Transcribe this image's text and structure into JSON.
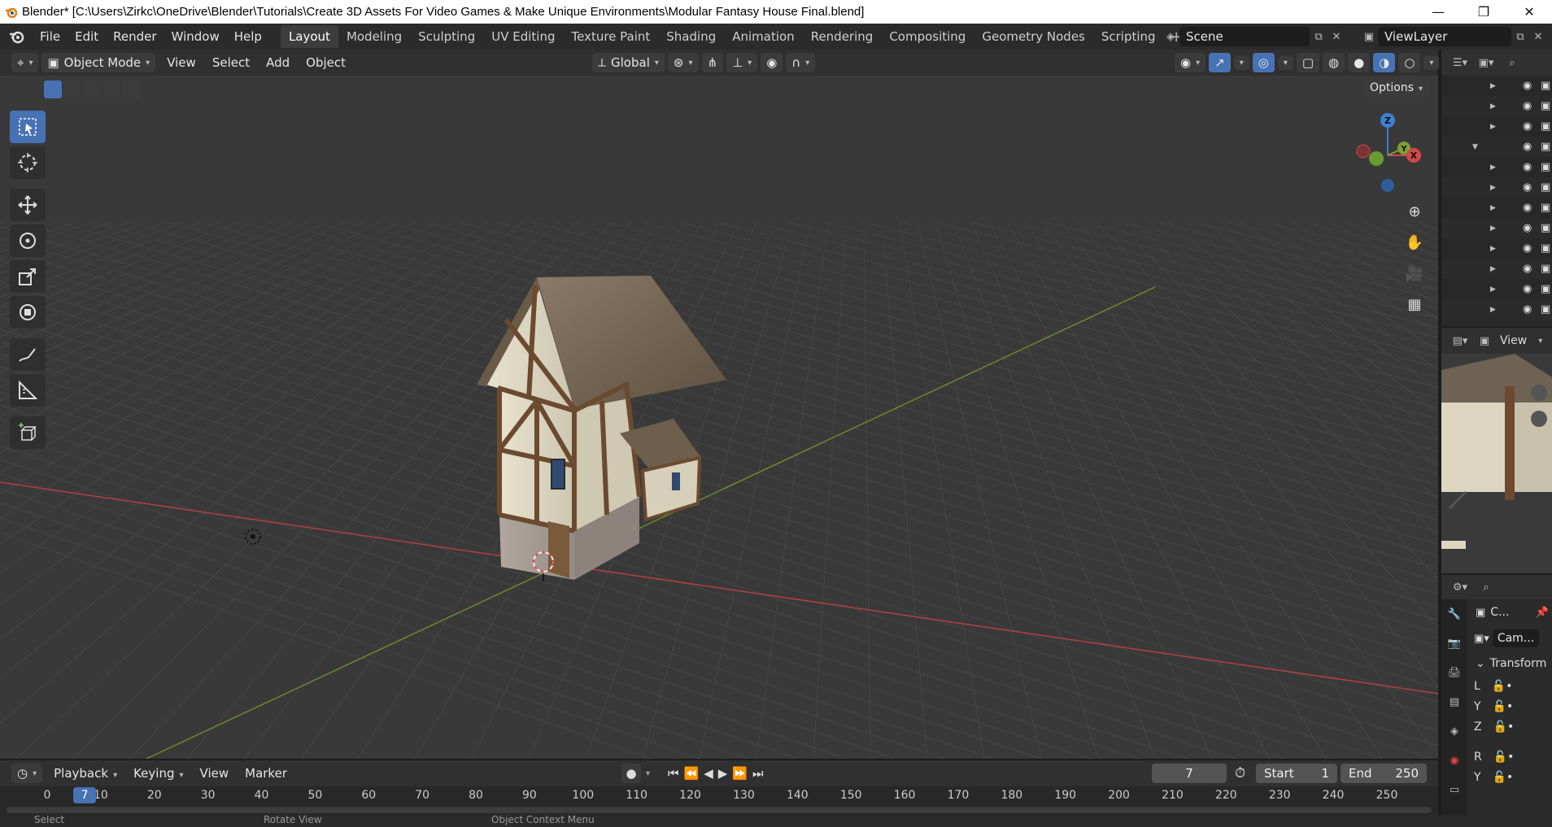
{
  "window": {
    "title": "Blender* [C:\\Users\\Zirkc\\OneDrive\\Blender\\Tutorials\\Create 3D Assets For Video Games & Make Unique Environments\\Modular Fantasy House Final.blend]",
    "minimize": "—",
    "maximize": "❐",
    "close": "✕"
  },
  "menu": [
    "File",
    "Edit",
    "Render",
    "Window",
    "Help"
  ],
  "workspaces": {
    "active": "Layout",
    "tabs": [
      "Layout",
      "Modeling",
      "Sculpting",
      "UV Editing",
      "Texture Paint",
      "Shading",
      "Animation",
      "Rendering",
      "Compositing",
      "Geometry Nodes",
      "Scripting"
    ],
    "add": "+"
  },
  "scene": {
    "name": "Scene"
  },
  "view_layer": {
    "name": "ViewLayer"
  },
  "viewport_header": {
    "mode": "Object Mode",
    "menus": [
      "View",
      "Select",
      "Add",
      "Object"
    ],
    "transform_orientation": "Global",
    "options": "Options"
  },
  "gizmo": {
    "z": "Z",
    "y": "Y",
    "x": "X"
  },
  "outliner": {
    "rows": 12
  },
  "preview_panel": {
    "view_label": "View"
  },
  "properties": {
    "object_short": "C...",
    "object_name": "Cam...",
    "section": "Transform",
    "rows": [
      "L",
      "Y",
      "Z",
      "R",
      "Y"
    ]
  },
  "timeline": {
    "menus": [
      "Playback",
      "Keying",
      "View",
      "Marker"
    ],
    "current_frame": "7",
    "start_label": "Start",
    "start": "1",
    "end_label": "End",
    "end": "250",
    "ruler": [
      "0",
      "10",
      "20",
      "30",
      "40",
      "50",
      "60",
      "70",
      "80",
      "90",
      "100",
      "110",
      "120",
      "130",
      "140",
      "150",
      "160",
      "170",
      "180",
      "190",
      "200",
      "210",
      "220",
      "230",
      "240",
      "250"
    ],
    "playhead_label": "7"
  },
  "statusbar": {
    "left": "Select",
    "mid": "Rotate View",
    "right": "Object Context Menu"
  },
  "colors": {
    "accent": "#4772b3",
    "x_axis": "#d44848",
    "y_axis": "#7ea030",
    "z_axis": "#3f7fd4"
  }
}
